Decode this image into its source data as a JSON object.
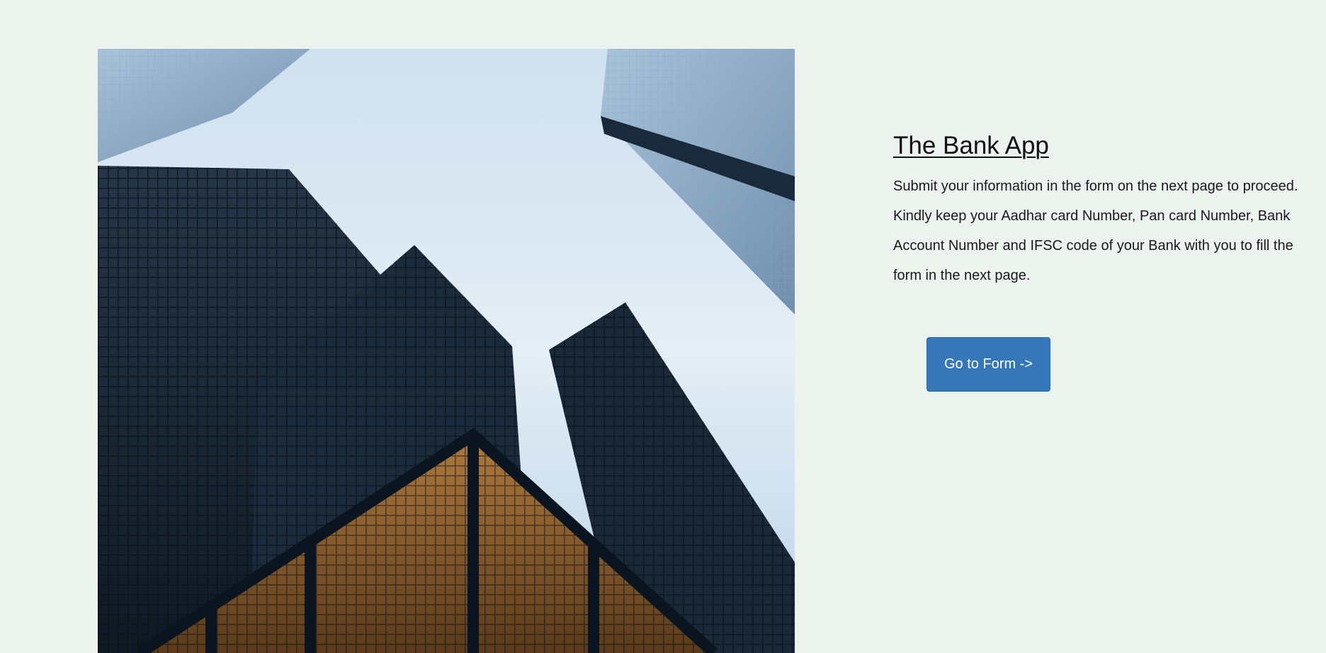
{
  "app": {
    "title": "The Bank App",
    "description": "Submit your information in the form on the next page to proceed. Kindly keep your Aadhar card Number, Pan card Number, Bank Account Number and IFSC code of your Bank with you to fill the form in the next page.",
    "button_label": "Go to Form ->"
  },
  "colors": {
    "background": "#ecf2ee",
    "button": "#3577b8",
    "button_text": "#ffffff"
  }
}
